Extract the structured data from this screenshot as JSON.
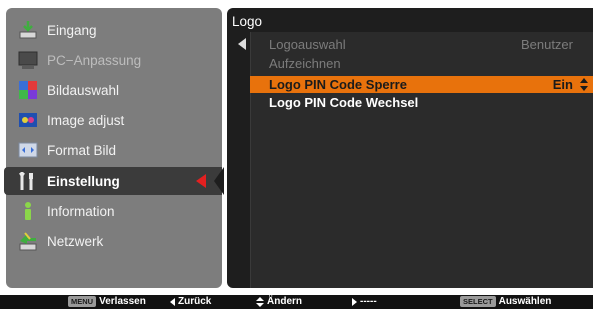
{
  "left_menu": {
    "items": [
      {
        "label": "Eingang",
        "icon": "input-icon"
      },
      {
        "label": "PC−Anpassung",
        "icon": "pc-adjust-icon"
      },
      {
        "label": "Bildauswahl",
        "icon": "image-select-icon"
      },
      {
        "label": "Image adjust",
        "icon": "image-adjust-icon"
      },
      {
        "label": "Format Bild",
        "icon": "screen-format-icon"
      },
      {
        "label": "Einstellung",
        "icon": "setting-icon"
      },
      {
        "label": "Information",
        "icon": "information-icon"
      },
      {
        "label": "Netzwerk",
        "icon": "network-icon"
      }
    ],
    "selected_index": 5
  },
  "right_panel": {
    "title": "Logo",
    "rows": [
      {
        "label": "Logoauswahl",
        "value": "Benutzer",
        "state": "disabled"
      },
      {
        "label": "Aufzeichnen",
        "value": "",
        "state": "disabled"
      },
      {
        "label": "Logo PIN Code Sperre",
        "value": "Ein",
        "state": "highlight"
      },
      {
        "label": "Logo PIN Code Wechsel",
        "value": "",
        "state": "normal"
      }
    ]
  },
  "bottom_bar": {
    "exit_key": "MENU",
    "exit_label": "Verlassen",
    "back_label": "Zurück",
    "change_label": "Ändern",
    "next_label": "-----",
    "select_key": "SELECT",
    "select_label": "Auswählen"
  },
  "colors": {
    "highlight": "#e8720c",
    "selector_arrow": "#e32020",
    "left_panel_bg": "#7d7d7d",
    "right_panel_bg": "#1e1e1e"
  }
}
